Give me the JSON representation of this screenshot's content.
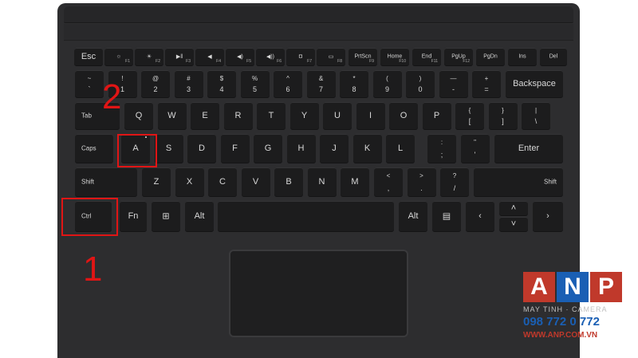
{
  "annotations": {
    "step1": "1",
    "step2": "2"
  },
  "keys": {
    "esc": "Esc",
    "prtscn": "PrtScn",
    "home": "Home",
    "end": "End",
    "pgup": "PgUp",
    "pgdn": "PgDn",
    "ins": "Ins",
    "del": "Del",
    "f1": "F1",
    "f2": "F2",
    "f3": "F3",
    "f4": "F4",
    "f5": "F5",
    "f6": "F6",
    "f7": "F7",
    "f8": "F8",
    "f9": "F9",
    "f10": "F10",
    "f11": "F11",
    "f12": "F12",
    "backspace": "Backspace",
    "tab": "Tab",
    "caps": "Caps",
    "enter": "Enter",
    "shift": "Shift",
    "ctrl": "Ctrl",
    "fn": "Fn",
    "alt": "Alt",
    "row1": [
      [
        "~",
        "`"
      ],
      [
        "!",
        "1"
      ],
      [
        "@",
        "2"
      ],
      [
        "#",
        "3"
      ],
      [
        "$",
        "4"
      ],
      [
        "%",
        "5"
      ],
      [
        "^",
        "6"
      ],
      [
        "&",
        "7"
      ],
      [
        "*",
        "8"
      ],
      [
        "(",
        "9"
      ],
      [
        ")",
        "0"
      ],
      [
        "—",
        "-"
      ],
      [
        "+",
        "="
      ]
    ],
    "row2": [
      "Q",
      "W",
      "E",
      "R",
      "T",
      "Y",
      "U",
      "I",
      "O",
      "P"
    ],
    "row2sym": [
      [
        "{",
        "["
      ],
      [
        "}",
        "]"
      ],
      [
        "|",
        "\\"
      ]
    ],
    "row3": [
      "A",
      "S",
      "D",
      "F",
      "G",
      "H",
      "J",
      "K",
      "L"
    ],
    "row3sym": [
      [
        ":",
        ";"
      ],
      [
        "\"",
        "'"
      ]
    ],
    "row4": [
      "Z",
      "X",
      "C",
      "V",
      "B",
      "N",
      "M"
    ],
    "row4sym": [
      [
        "<",
        ","
      ],
      [
        ">",
        "."
      ],
      [
        "?",
        "/"
      ]
    ]
  },
  "logo": {
    "a": "A",
    "n": "N",
    "p": "P",
    "tagline": "MAY TINH · CAMERA",
    "phone": "098 772 0 772",
    "url": "WWW.ANP.COM.VN"
  },
  "colors": {
    "highlight": "#e01515",
    "logo_red": "#c0392b",
    "logo_blue": "#1a5fb4"
  }
}
